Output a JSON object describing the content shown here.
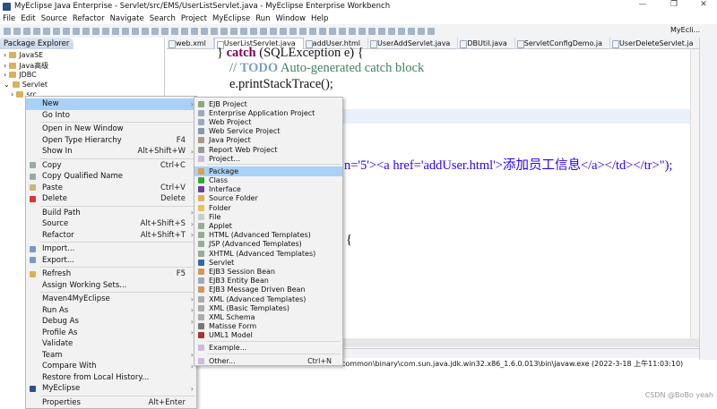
{
  "window": {
    "title": "MyEclipse Java Enterprise - Servlet/src/EMS/UserListServlet.java - MyEclipse Enterprise Workbench",
    "minimize": "—",
    "maximize": "❐",
    "close": "✕"
  },
  "menubar": [
    "File",
    "Edit",
    "Source",
    "Refactor",
    "Navigate",
    "Search",
    "Project",
    "MyEclipse",
    "Run",
    "Window",
    "Help"
  ],
  "perspective": "MyEcli...",
  "explorer": {
    "title": "Package Explorer",
    "items": [
      {
        "label": "JavaSE",
        "expanded": false
      },
      {
        "label": "Java高级",
        "expanded": false
      },
      {
        "label": "JDBC",
        "expanded": false
      },
      {
        "label": "Servlet",
        "expanded": true
      },
      {
        "label": "src",
        "expanded": false
      }
    ]
  },
  "editor_tabs": [
    {
      "label": "web.xml"
    },
    {
      "label": "UserListServlet.java",
      "active": true
    },
    {
      "label": "addUser.html"
    },
    {
      "label": "UserAddServlet.java"
    },
    {
      "label": "DBUtil.java"
    },
    {
      "label": "ServletConfigDemo.ja"
    },
    {
      "label": "UserDeleteServlet.ja"
    }
  ],
  "code": {
    "l1_brace": "} ",
    "l1_kw": "catch",
    "l1_rest": " (SQLException e) {",
    "l2_prefix": "// ",
    "l2_todo": "TODO",
    "l2_rest": " Auto-generated catch block",
    "l3": "e.printStackTrace();",
    "l4": "n='5'><a href='addUser.html'>添加员工信息</a></td></tr>\");",
    "l5": "{"
  },
  "console": {
    "path": "common\\binary\\com.sun.java.jdk.win32.x86_1.6.0.013\\bin\\javaw.exe  (2022-3-18 上午11:03:10)"
  },
  "watermark": "CSDN @BoBo yeah",
  "context_menu": [
    {
      "label": "New",
      "arrow": true,
      "highlighted": true
    },
    {
      "label": "Go Into"
    },
    {
      "sep": true
    },
    {
      "label": "Open in New Window"
    },
    {
      "label": "Open Type Hierarchy",
      "shortcut": "F4"
    },
    {
      "label": "Show In",
      "shortcut": "Alt+Shift+W",
      "arrow": true
    },
    {
      "sep": true
    },
    {
      "label": "Copy",
      "shortcut": "Ctrl+C",
      "icon": "copy-icon",
      "color": "#9aa"
    },
    {
      "label": "Copy Qualified Name",
      "icon": "copy-qualified-icon",
      "color": "#9aa"
    },
    {
      "label": "Paste",
      "shortcut": "Ctrl+V",
      "icon": "paste-icon",
      "color": "#c9b77a"
    },
    {
      "label": "Delete",
      "shortcut": "Delete",
      "icon": "delete-icon",
      "color": "#d33"
    },
    {
      "sep": true
    },
    {
      "label": "Build Path",
      "arrow": true
    },
    {
      "label": "Source",
      "shortcut": "Alt+Shift+S",
      "arrow": true
    },
    {
      "label": "Refactor",
      "shortcut": "Alt+Shift+T",
      "arrow": true
    },
    {
      "sep": true
    },
    {
      "label": "Import...",
      "icon": "import-icon",
      "color": "#7a9ac0"
    },
    {
      "label": "Export...",
      "icon": "export-icon",
      "color": "#7a9ac0"
    },
    {
      "sep": true
    },
    {
      "label": "Refresh",
      "shortcut": "F5",
      "icon": "refresh-icon",
      "color": "#e0b050"
    },
    {
      "label": "Assign Working Sets..."
    },
    {
      "sep": true
    },
    {
      "label": "Maven4MyEclipse",
      "arrow": true
    },
    {
      "label": "Run As",
      "arrow": true
    },
    {
      "label": "Debug As",
      "arrow": true
    },
    {
      "label": "Profile As",
      "arrow": true
    },
    {
      "label": "Validate"
    },
    {
      "label": "Team",
      "arrow": true
    },
    {
      "label": "Compare With",
      "arrow": true
    },
    {
      "label": "Restore from Local History..."
    },
    {
      "label": "MyEclipse",
      "arrow": true,
      "icon": "myeclipse-icon",
      "color": "#2b4f8a"
    },
    {
      "sep": true
    },
    {
      "label": "Properties",
      "shortcut": "Alt+Enter"
    }
  ],
  "new_submenu": [
    {
      "label": "EJB Project",
      "icon": "ejb-project-icon",
      "color": "#8a7"
    },
    {
      "label": "Enterprise Application Project",
      "icon": "ear-project-icon",
      "color": "#9ab"
    },
    {
      "label": "Web Project",
      "icon": "web-project-icon",
      "color": "#9ab"
    },
    {
      "label": "Web Service Project",
      "icon": "web-service-icon",
      "color": "#89a"
    },
    {
      "label": "Java Project",
      "icon": "java-project-icon",
      "color": "#a98"
    },
    {
      "label": "Report Web Project",
      "icon": "report-icon",
      "color": "#999"
    },
    {
      "label": "Project...",
      "icon": "project-icon",
      "color": "#cbd"
    },
    {
      "sep": true
    },
    {
      "label": "Package",
      "icon": "package-icon",
      "color": "#d9a050",
      "highlighted": true
    },
    {
      "label": "Class",
      "icon": "class-icon",
      "color": "#3a3"
    },
    {
      "label": "Interface",
      "icon": "interface-icon",
      "color": "#649"
    },
    {
      "label": "Source Folder",
      "icon": "source-folder-icon",
      "color": "#d9b25d"
    },
    {
      "label": "Folder",
      "icon": "folder-icon",
      "color": "#e8c060"
    },
    {
      "label": "File",
      "icon": "file-icon",
      "color": "#ccc"
    },
    {
      "label": "Applet",
      "icon": "applet-icon",
      "color": "#9a9"
    },
    {
      "label": "HTML (Advanced Templates)",
      "icon": "html-icon",
      "color": "#9a9"
    },
    {
      "label": "JSP (Advanced Templates)",
      "icon": "jsp-icon",
      "color": "#9a9"
    },
    {
      "label": "XHTML (Advanced Templates)",
      "icon": "xhtml-icon",
      "color": "#9a9"
    },
    {
      "label": "Servlet",
      "icon": "servlet-icon",
      "color": "#36a"
    },
    {
      "label": "EJB3 Session Bean",
      "icon": "session-bean-icon",
      "color": "#c96"
    },
    {
      "label": "EJB3 Entity Bean",
      "icon": "entity-bean-icon",
      "color": "#9ab"
    },
    {
      "label": "EJB3 Message Driven Bean",
      "icon": "mdb-icon",
      "color": "#c96"
    },
    {
      "label": "XML (Advanced Templates)",
      "icon": "xml-icon",
      "color": "#aaa"
    },
    {
      "label": "XML (Basic Templates)",
      "icon": "xml-basic-icon",
      "color": "#aaa"
    },
    {
      "label": "XML Schema",
      "icon": "xml-schema-icon",
      "color": "#aaa"
    },
    {
      "label": "Matisse Form",
      "icon": "matisse-icon",
      "color": "#777"
    },
    {
      "label": "UML1 Model",
      "icon": "uml-icon",
      "color": "#a33"
    },
    {
      "sep": true
    },
    {
      "label": "Example...",
      "icon": "example-icon",
      "color": "#cbd"
    },
    {
      "sep": true
    },
    {
      "label": "Other...",
      "shortcut": "Ctrl+N",
      "icon": "other-icon",
      "color": "#cbd"
    }
  ]
}
